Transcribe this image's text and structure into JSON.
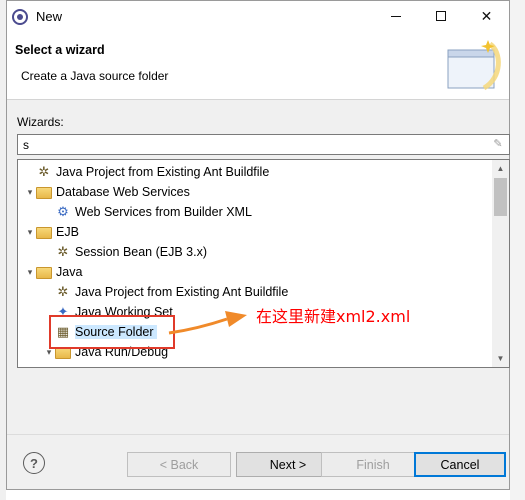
{
  "window": {
    "title": "New"
  },
  "header": {
    "title": "Select a wizard",
    "subtitle": "Create a Java source folder"
  },
  "wizards_label": "Wizards:",
  "filter": {
    "value": "s"
  },
  "tree": {
    "items": [
      {
        "label": "Java Project from Existing Ant Buildfile",
        "level": 0,
        "icon": "ant-wizard-icon",
        "expand": ""
      },
      {
        "label": "Database Web Services",
        "level": 0,
        "icon": "folder-icon",
        "expand": "open"
      },
      {
        "label": "Web Services from Builder XML",
        "level": 1,
        "icon": "webservice-icon",
        "expand": ""
      },
      {
        "label": "EJB",
        "level": 0,
        "icon": "folder-icon",
        "expand": "open"
      },
      {
        "label": "Session Bean (EJB 3.x)",
        "level": 1,
        "icon": "bean-wizard-icon",
        "expand": ""
      },
      {
        "label": "Java",
        "level": 0,
        "icon": "folder-icon",
        "expand": "open"
      },
      {
        "label": "Java Project from Existing Ant Buildfile",
        "level": 1,
        "icon": "ant-wizard-icon",
        "expand": ""
      },
      {
        "label": "Java Working Set",
        "level": 1,
        "icon": "working-set-icon",
        "expand": ""
      },
      {
        "label": "Source Folder",
        "level": 1,
        "icon": "source-folder-icon",
        "expand": "",
        "selected": true
      },
      {
        "label": "Java Run/Debug",
        "level": 1,
        "icon": "folder-icon",
        "expand": "open"
      }
    ]
  },
  "annotation": {
    "text": "在这里新建xml2.xml",
    "color": "#ff0000"
  },
  "buttons": {
    "back": "< Back",
    "next": "Next >",
    "finish": "Finish",
    "cancel": "Cancel",
    "help": "?"
  }
}
